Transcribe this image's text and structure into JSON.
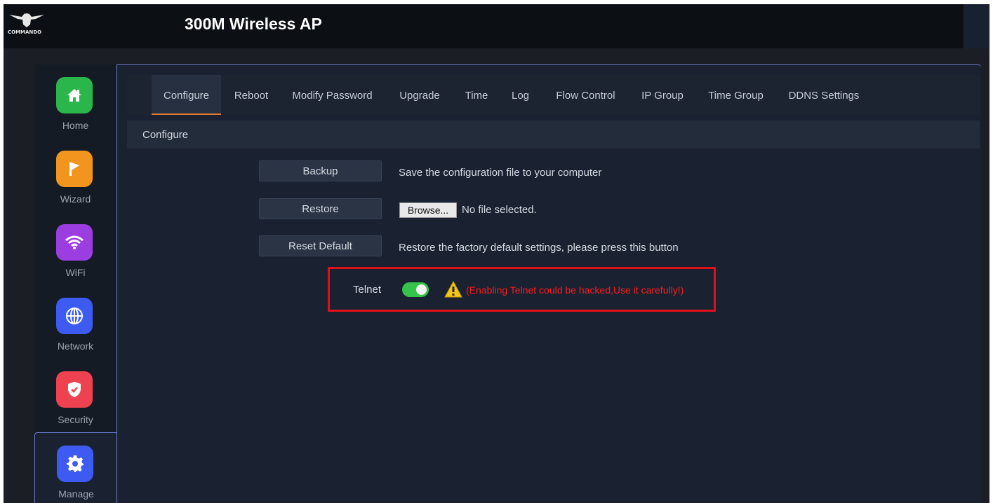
{
  "header": {
    "logo_text": "COMMANDO",
    "title": "300M Wireless AP"
  },
  "sidebar": {
    "items": [
      {
        "label": "Home",
        "color": "#2ab64a",
        "icon": "home-icon"
      },
      {
        "label": "Wizard",
        "color": "#f2951f",
        "icon": "flag-icon"
      },
      {
        "label": "WiFi",
        "color": "#9b3de0",
        "icon": "wifi-icon"
      },
      {
        "label": "Network",
        "color": "#3d5bf0",
        "icon": "globe-icon"
      },
      {
        "label": "Security",
        "color": "#ee4250",
        "icon": "shield-icon"
      },
      {
        "label": "Manage",
        "color": "#3d5bf0",
        "icon": "gear-icon",
        "active": true
      }
    ]
  },
  "tabs": [
    {
      "label": "Configure",
      "active": true
    },
    {
      "label": "Reboot"
    },
    {
      "label": "Modify Password"
    },
    {
      "label": "Upgrade"
    },
    {
      "label": "Time"
    },
    {
      "label": "Log"
    },
    {
      "label": "Flow Control"
    },
    {
      "label": "IP Group"
    },
    {
      "label": "Time Group"
    },
    {
      "label": "DDNS Settings"
    }
  ],
  "section": {
    "title": "Configure"
  },
  "actions": {
    "backup_label": "Backup",
    "backup_desc": "Save the configuration file to your computer",
    "restore_label": "Restore",
    "browse_label": "Browse...",
    "file_status": "No file selected.",
    "reset_label": "Reset Default",
    "reset_desc": "Restore the factory default settings, please press this button"
  },
  "telnet": {
    "label": "Telnet",
    "enabled": true,
    "warning": "(Enabling Telnet could be hacked,Use it carefully!)"
  },
  "colors": {
    "accent_tab_underline": "#e07a2f",
    "toggle_on": "#35c34a",
    "warning_text": "#ff1a1a",
    "highlight_box": "#e0101a"
  }
}
